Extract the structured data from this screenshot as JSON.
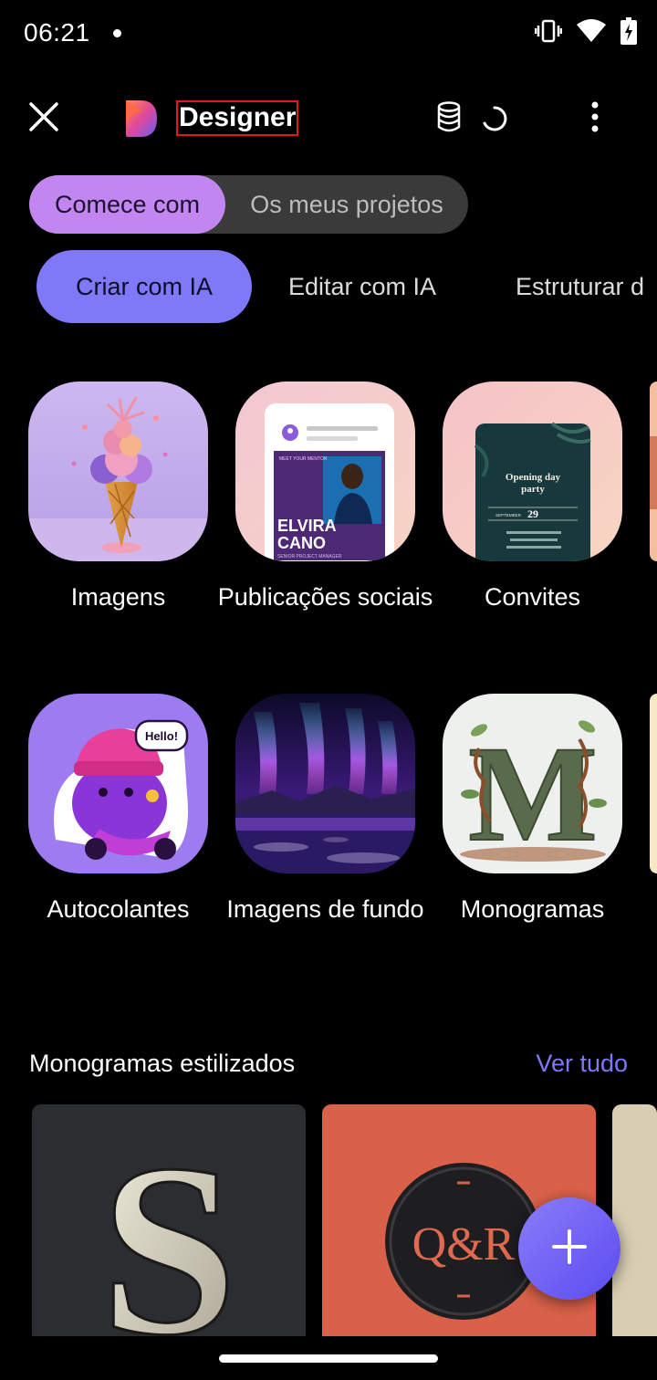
{
  "status_bar": {
    "time": "06:21",
    "icons": [
      "vibrate-icon",
      "wifi-icon",
      "battery-charging-icon"
    ]
  },
  "header": {
    "title": "Designer",
    "icons": [
      "close-icon",
      "designer-logo",
      "coins-icon",
      "loading-spinner-icon",
      "more-vert-icon"
    ]
  },
  "segmented": {
    "active": "Comece com",
    "inactive": "Os meus projetos"
  },
  "chips": {
    "items": [
      "Criar com IA",
      "Editar com IA",
      "Estruturar d"
    ]
  },
  "grid": {
    "row1": [
      "Imagens",
      "Publicações sociais",
      "Convites"
    ],
    "row2": [
      "Autocolantes",
      "Imagens de fundo",
      "Monogramas"
    ]
  },
  "thumbnail_text": {
    "social_name_1": "ELVIRA",
    "social_name_2": "CANO",
    "social_role": "SENIOR PROJECT MANAGER",
    "social_meet": "MEET YOUR MENTOR",
    "invite_title_1": "Opening day",
    "invite_title_2": "party",
    "invite_day": "29",
    "invite_month": "SEPTEMBER",
    "sticker_bubble": "Hello!",
    "monogram_letter": "M"
  },
  "section": {
    "title": "Monogramas estilizados",
    "see_all": "Ver tudo",
    "card_letters": [
      "S",
      "Q&R"
    ]
  },
  "fab": {
    "icon": "plus-icon"
  },
  "colors": {
    "accent": "#7f79f7",
    "segment_active": "#c286f0",
    "background": "#000000"
  }
}
